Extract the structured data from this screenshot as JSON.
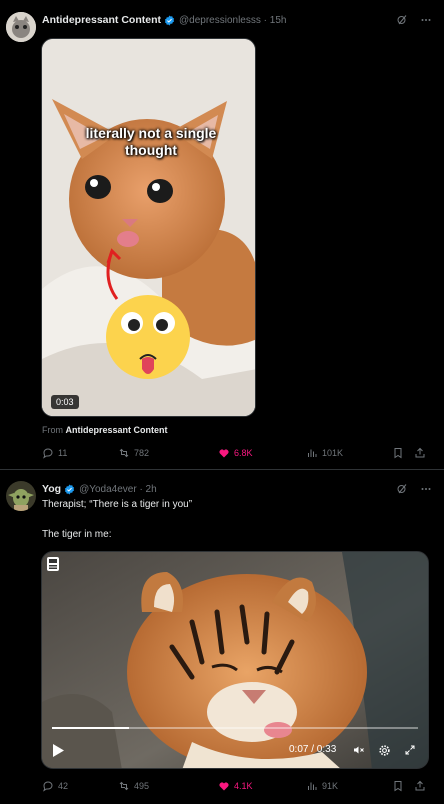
{
  "post1": {
    "author_name": "Antidepressant Content",
    "handle_time": "@depressionlesss · 15h",
    "meme_caption": "literally not a single thought",
    "video_time": "0:03",
    "from_prefix": "From",
    "from_account": "Antidepressant Content",
    "replies": "11",
    "reposts": "782",
    "likes": "6.8K",
    "views": "101K"
  },
  "post2": {
    "author_name": "Yog",
    "handle_time": "@Yoda4ever · 2h",
    "text_line1": "Therapist; “There is a tiger in you”",
    "text_line2": "The tiger in me:",
    "video_time": "0:07 / 0:33",
    "video_progress": 0.21,
    "replies": "42",
    "reposts": "495",
    "likes": "4.1K",
    "views": "91K"
  },
  "colors": {
    "background": "#000000",
    "text": "#e7e9ea",
    "muted": "#71767b",
    "verified": "#1d9bf0",
    "like": "#f91880"
  },
  "icons": [
    "verified-badge-icon",
    "grok-icon",
    "more-icon",
    "reply-icon",
    "repost-icon",
    "like-icon",
    "views-icon",
    "bookmark-icon",
    "share-icon",
    "play-icon",
    "mute-icon",
    "settings-icon",
    "fullscreen-icon"
  ]
}
